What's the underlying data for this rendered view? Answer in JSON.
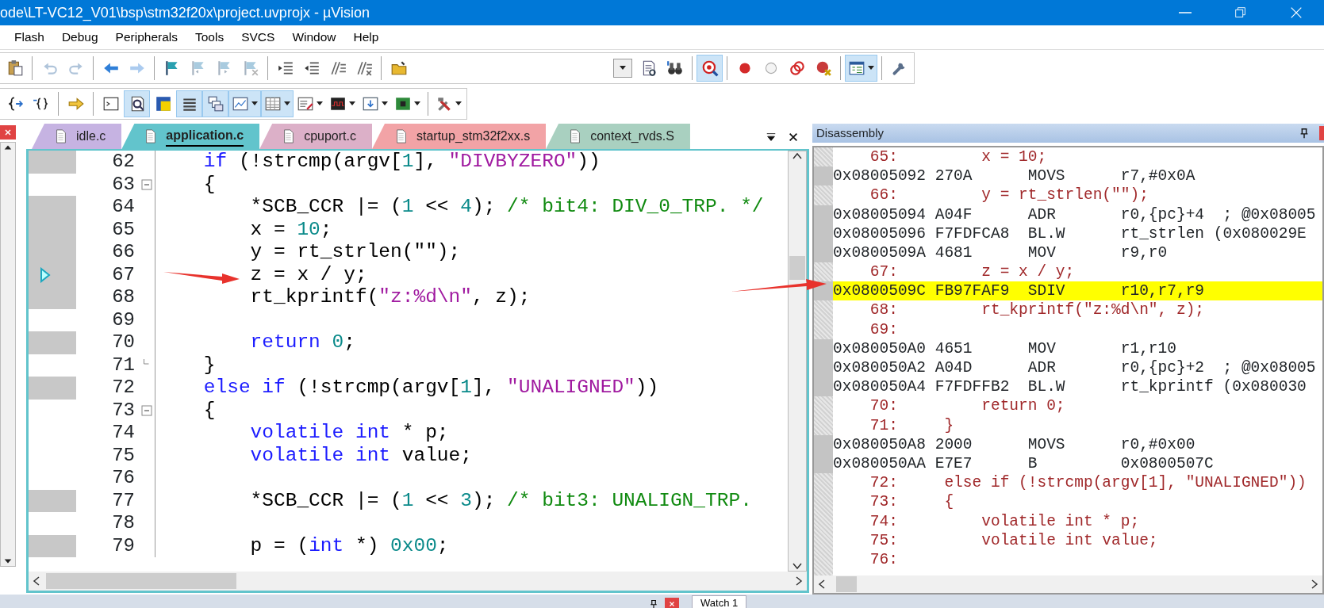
{
  "window": {
    "title": "ode\\LT-VC12_V01\\bsp\\stm32f20x\\project.uvprojx - µVision"
  },
  "menu": [
    "Flash",
    "Debug",
    "Peripherals",
    "Tools",
    "SVCS",
    "Window",
    "Help"
  ],
  "toolbar_1": {
    "left": [
      [
        {
          "pressed": false,
          "disabled": false
        }
      ],
      [
        {
          "pressed": false,
          "disabled": true
        },
        {
          "pressed": false,
          "disabled": true
        }
      ],
      [
        {
          "pressed": false,
          "disabled": false
        },
        {
          "pressed": false,
          "disabled": true
        }
      ],
      [
        {
          "pressed": false,
          "disabled": false
        },
        {
          "pressed": false,
          "disabled": true
        },
        {
          "pressed": false,
          "disabled": true
        },
        {
          "pressed": false,
          "disabled": true
        }
      ],
      [
        {
          "pressed": false,
          "disabled": false
        },
        {
          "pressed": false,
          "disabled": false
        },
        {
          "pressed": false,
          "disabled": false
        },
        {
          "pressed": false,
          "disabled": false
        }
      ],
      [
        {
          "pressed": false,
          "disabled": false
        }
      ]
    ],
    "right": [
      [
        {
          "dropdown": true
        },
        {
          "pressed": false,
          "disabled": false
        },
        {
          "pressed": false,
          "disabled": false
        }
      ],
      [
        {
          "pressed": true,
          "disabled": false
        }
      ],
      [
        {
          "pressed": false,
          "disabled": false
        },
        {
          "pressed": false,
          "disabled": false
        },
        {
          "pressed": false,
          "disabled": false
        },
        {
          "pressed": false,
          "disabled": false
        }
      ],
      [
        {
          "pressed": true,
          "disabled": false,
          "dropdown": true
        }
      ],
      [
        {
          "pressed": false,
          "disabled": false
        }
      ]
    ]
  },
  "toolbar_2": [
    [
      {
        "pressed": false,
        "disabled": false
      },
      {
        "pressed": false,
        "disabled": false
      }
    ],
    [
      {
        "pressed": false,
        "disabled": false
      }
    ],
    [
      {
        "pressed": false,
        "disabled": false
      },
      {
        "pressed": true,
        "disabled": false
      },
      {
        "pressed": false,
        "disabled": false
      },
      {
        "pressed": true,
        "disabled": false
      },
      {
        "pressed": true,
        "disabled": false
      },
      {
        "pressed": true,
        "disabled": false,
        "dropdown": true
      },
      {
        "pressed": true,
        "disabled": false,
        "dropdown": true
      },
      {
        "pressed": false,
        "disabled": false,
        "dropdown": true
      },
      {
        "pressed": false,
        "disabled": false,
        "dropdown": true
      },
      {
        "pressed": false,
        "disabled": false,
        "dropdown": true
      },
      {
        "pressed": false,
        "disabled": false,
        "dropdown": true
      }
    ],
    [
      {
        "pressed": false,
        "disabled": false,
        "dropdown": true
      }
    ]
  ],
  "editor": {
    "tabs": [
      {
        "label": "idle.c",
        "color": "#c6b3e2",
        "selected": false
      },
      {
        "label": "application.c",
        "color": "#62c4cc",
        "selected": true
      },
      {
        "label": "cpuport.c",
        "color": "#dcb0c8",
        "selected": false
      },
      {
        "label": "startup_stm32f2xx.s",
        "color": "#f2a3a6",
        "selected": false
      },
      {
        "label": "context_rvds.S",
        "color": "#a9d0c0",
        "selected": false
      }
    ],
    "lines": [
      {
        "number": "62",
        "executable": true,
        "current": false,
        "collapsible": false,
        "block_end": false,
        "tokens": [
          {
            "text": "    if",
            "kind": "keyword"
          },
          {
            "text": " (!strcmp(argv[",
            "kind": "plain"
          },
          {
            "text": "1",
            "kind": "number"
          },
          {
            "text": "], ",
            "kind": "plain"
          },
          {
            "text": "\"DIVBYZERO\"",
            "kind": "string"
          },
          {
            "text": "))",
            "kind": "plain"
          }
        ]
      },
      {
        "number": "63",
        "executable": false,
        "current": false,
        "collapsible": true,
        "block_end": false,
        "tokens": [
          {
            "text": "    {",
            "kind": "plain"
          }
        ]
      },
      {
        "number": "64",
        "executable": true,
        "current": false,
        "collapsible": false,
        "block_end": false,
        "tokens": [
          {
            "text": "        *SCB_CCR |= (",
            "kind": "plain"
          },
          {
            "text": "1",
            "kind": "number"
          },
          {
            "text": " << ",
            "kind": "plain"
          },
          {
            "text": "4",
            "kind": "number"
          },
          {
            "text": "); ",
            "kind": "plain"
          },
          {
            "text": "/* bit4: DIV_0_TRP. */",
            "kind": "comment"
          }
        ]
      },
      {
        "number": "65",
        "executable": true,
        "current": false,
        "collapsible": false,
        "block_end": false,
        "tokens": [
          {
            "text": "        x = ",
            "kind": "plain"
          },
          {
            "text": "10",
            "kind": "number"
          },
          {
            "text": ";",
            "kind": "plain"
          }
        ]
      },
      {
        "number": "66",
        "executable": true,
        "current": false,
        "collapsible": false,
        "block_end": false,
        "tokens": [
          {
            "text": "        y = rt_strlen(\"\");",
            "kind": "plain"
          }
        ]
      },
      {
        "number": "67",
        "executable": true,
        "current": true,
        "collapsible": false,
        "block_end": false,
        "tokens": [
          {
            "text": "        z = x / y;",
            "kind": "plain"
          }
        ]
      },
      {
        "number": "68",
        "executable": true,
        "current": false,
        "collapsible": false,
        "block_end": false,
        "tokens": [
          {
            "text": "        rt_kprintf(",
            "kind": "plain"
          },
          {
            "text": "\"z:%d\\n\"",
            "kind": "string"
          },
          {
            "text": ", z);",
            "kind": "plain"
          }
        ]
      },
      {
        "number": "69",
        "executable": false,
        "current": false,
        "collapsible": false,
        "block_end": false
      },
      {
        "number": "70",
        "executable": true,
        "current": false,
        "collapsible": false,
        "block_end": false,
        "tokens": [
          {
            "text": "        return ",
            "kind": "keyword"
          },
          {
            "text": "0",
            "kind": "number"
          },
          {
            "text": ";",
            "kind": "plain"
          }
        ]
      },
      {
        "number": "71",
        "executable": false,
        "current": false,
        "collapsible": false,
        "block_end": true,
        "tokens": [
          {
            "text": "    }",
            "kind": "plain"
          }
        ]
      },
      {
        "number": "72",
        "executable": true,
        "current": false,
        "collapsible": false,
        "block_end": false,
        "tokens": [
          {
            "text": "    else if",
            "kind": "keyword"
          },
          {
            "text": " (!strcmp(argv[",
            "kind": "plain"
          },
          {
            "text": "1",
            "kind": "number"
          },
          {
            "text": "], ",
            "kind": "plain"
          },
          {
            "text": "\"UNALIGNED\"",
            "kind": "string"
          },
          {
            "text": "))",
            "kind": "plain"
          }
        ]
      },
      {
        "number": "73",
        "executable": false,
        "current": false,
        "collapsible": true,
        "block_end": false,
        "tokens": [
          {
            "text": "    {",
            "kind": "plain"
          }
        ]
      },
      {
        "number": "74",
        "executable": false,
        "current": false,
        "collapsible": false,
        "block_end": false,
        "tokens": [
          {
            "text": "        volatile int",
            "kind": "keyword"
          },
          {
            "text": " * p;",
            "kind": "plain"
          }
        ]
      },
      {
        "number": "75",
        "executable": false,
        "current": false,
        "collapsible": false,
        "block_end": false,
        "tokens": [
          {
            "text": "        volatile int",
            "kind": "keyword"
          },
          {
            "text": " value;",
            "kind": "plain"
          }
        ]
      },
      {
        "number": "76",
        "executable": false,
        "current": false,
        "collapsible": false,
        "block_end": false
      },
      {
        "number": "77",
        "executable": true,
        "current": false,
        "collapsible": false,
        "block_end": false,
        "tokens": [
          {
            "text": "        *SCB_CCR |= (",
            "kind": "plain"
          },
          {
            "text": "1",
            "kind": "number"
          },
          {
            "text": " << ",
            "kind": "plain"
          },
          {
            "text": "3",
            "kind": "number"
          },
          {
            "text": "); ",
            "kind": "plain"
          },
          {
            "text": "/* bit3: UNALIGN_TRP.",
            "kind": "comment"
          }
        ]
      },
      {
        "number": "78",
        "executable": false,
        "current": false,
        "collapsible": false,
        "block_end": false
      },
      {
        "number": "79",
        "executable": true,
        "current": false,
        "collapsible": false,
        "block_end": false,
        "tokens": [
          {
            "text": "        p = (",
            "kind": "plain"
          },
          {
            "text": "int",
            "kind": "keyword"
          },
          {
            "text": " *) ",
            "kind": "plain"
          },
          {
            "text": "0x00",
            "kind": "number"
          },
          {
            "text": ";",
            "kind": "plain"
          }
        ]
      }
    ]
  },
  "disassembly": {
    "title": "Disassembly",
    "lines": [
      {
        "kind": "source",
        "text": "    65:         x = 10;",
        "current": false
      },
      {
        "kind": "asm",
        "text": "0x08005092 270A      MOVS      r7,#0x0A",
        "current": false
      },
      {
        "kind": "source",
        "text": "    66:         y = rt_strlen(\"\");",
        "current": false
      },
      {
        "kind": "asm",
        "text": "0x08005094 A04F      ADR       r0,{pc}+4  ; @0x08005",
        "current": false
      },
      {
        "kind": "asm",
        "text": "0x08005096 F7FDFCA8  BL.W      rt_strlen (0x080029E",
        "current": false
      },
      {
        "kind": "asm",
        "text": "0x0800509A 4681      MOV       r9,r0",
        "current": false
      },
      {
        "kind": "source",
        "text": "    67:         z = x / y;",
        "current": false
      },
      {
        "kind": "asm",
        "text": "0x0800509C FB97FAF9  SDIV      r10,r7,r9",
        "current": true
      },
      {
        "kind": "source",
        "text": "    68:         rt_kprintf(\"z:%d\\n\", z);",
        "current": false
      },
      {
        "kind": "source",
        "text": "    69:",
        "current": false
      },
      {
        "kind": "asm",
        "text": "0x080050A0 4651      MOV       r1,r10",
        "current": false
      },
      {
        "kind": "asm",
        "text": "0x080050A2 A04D      ADR       r0,{pc}+2  ; @0x08005",
        "current": false
      },
      {
        "kind": "asm",
        "text": "0x080050A4 F7FDFFB2  BL.W      rt_kprintf (0x080030",
        "current": false
      },
      {
        "kind": "source",
        "text": "    70:         return 0;",
        "current": false
      },
      {
        "kind": "source",
        "text": "    71:     }",
        "current": false
      },
      {
        "kind": "asm",
        "text": "0x080050A8 2000      MOVS      r0,#0x00",
        "current": false
      },
      {
        "kind": "asm",
        "text": "0x080050AA E7E7      B         0x0800507C",
        "current": false
      },
      {
        "kind": "source",
        "text": "    72:     else if (!strcmp(argv[1], \"UNALIGNED\"))",
        "current": false
      },
      {
        "kind": "source",
        "text": "    73:     {",
        "current": false
      },
      {
        "kind": "source",
        "text": "    74:         volatile int * p;",
        "current": false
      },
      {
        "kind": "source",
        "text": "    75:         volatile int value;",
        "current": false
      },
      {
        "kind": "source",
        "text": "    76:",
        "current": false
      }
    ]
  },
  "bottom_panel": {
    "tabs": [
      {
        "label": "Watch 1"
      }
    ]
  }
}
